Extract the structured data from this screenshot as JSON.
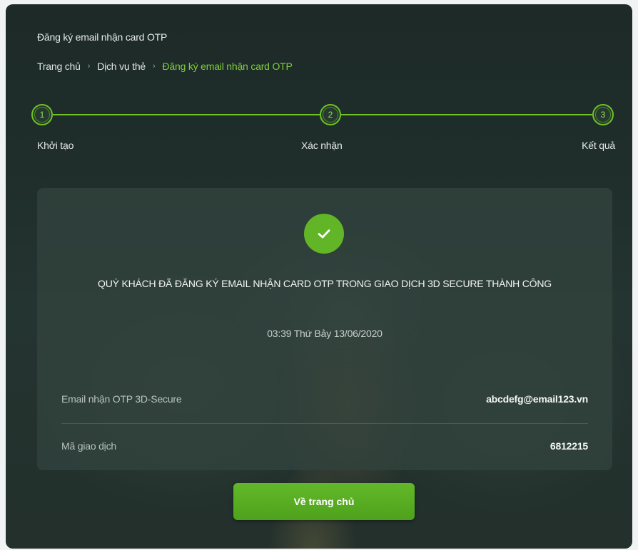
{
  "header": {
    "title": "Đăng ký email nhận card OTP"
  },
  "breadcrumb": {
    "items": [
      "Trang chủ",
      "Dịch vụ thẻ",
      "Đăng ký email nhận card OTP"
    ],
    "separator": "›"
  },
  "stepper": {
    "steps": [
      {
        "number": "1",
        "label": "Khởi tạo"
      },
      {
        "number": "2",
        "label": "Xác nhận"
      },
      {
        "number": "3",
        "label": "Kết quả"
      }
    ],
    "active_color": "#6fc128"
  },
  "result": {
    "icon": "check-circle-icon",
    "title": "QUÝ KHÁCH ĐÃ ĐĂNG KÝ EMAIL NHẬN CARD OTP TRONG GIAO DỊCH 3D SECURE THÀNH CÔNG",
    "timestamp": "03:39 Thứ Bảy 13/06/2020",
    "details": [
      {
        "label": "Email nhận OTP 3D-Secure",
        "value": "abcdefg@email123.vn"
      },
      {
        "label": "Mã giao dịch",
        "value": "6812215"
      }
    ]
  },
  "actions": {
    "home_label": "Về trang chủ"
  },
  "colors": {
    "accent": "#62b526",
    "breadcrumb_active": "#7fcf3a"
  }
}
